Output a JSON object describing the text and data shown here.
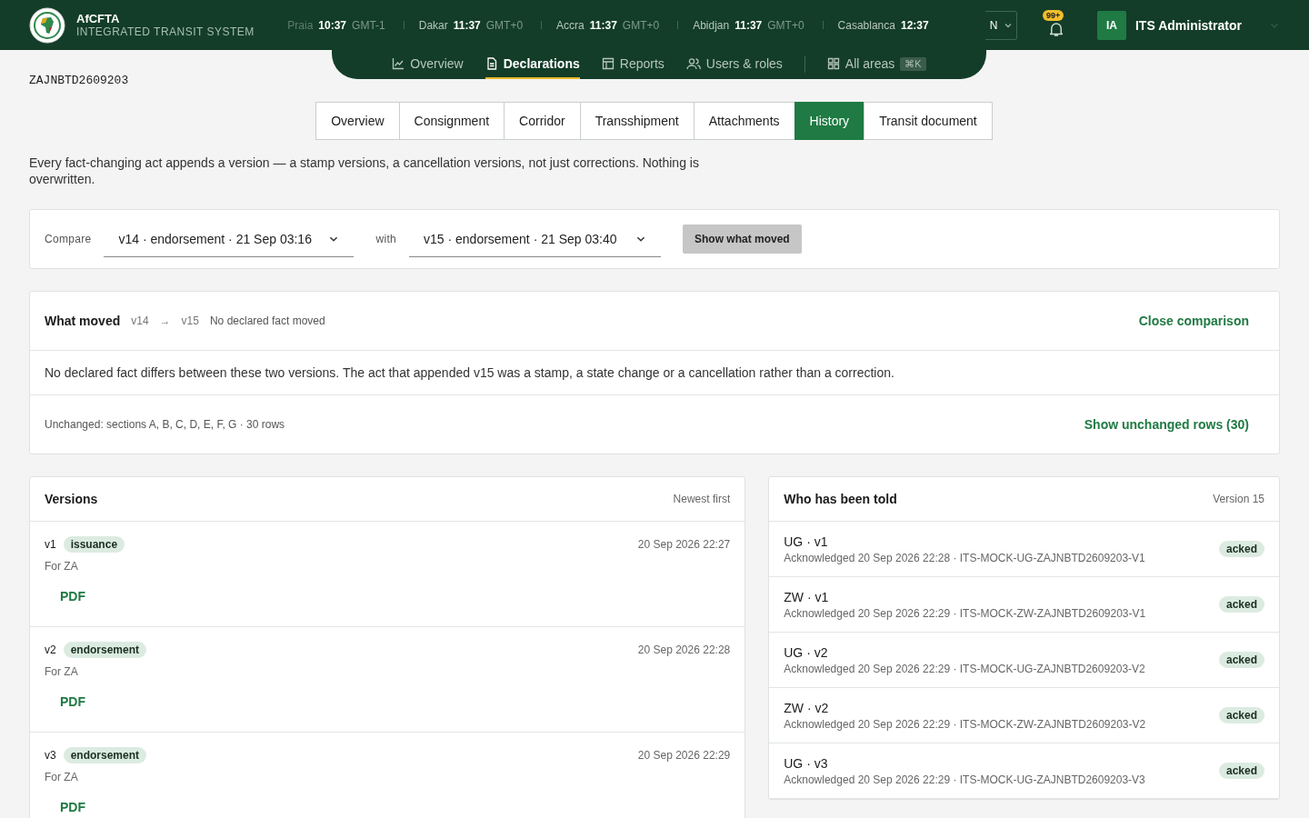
{
  "brand": {
    "name": "AfCFTA",
    "subtitle": "INTEGRATED TRANSIT SYSTEM"
  },
  "clocks": [
    {
      "city": "Praia",
      "time": "10:37",
      "zone": "GMT-1"
    },
    {
      "city": "Dakar",
      "time": "11:37",
      "zone": "GMT+0"
    },
    {
      "city": "Accra",
      "time": "11:37",
      "zone": "GMT+0"
    },
    {
      "city": "Abidjan",
      "time": "11:37",
      "zone": "GMT+0"
    },
    {
      "city": "Casablanca",
      "time": "12:37"
    }
  ],
  "language": {
    "value": "N"
  },
  "notifications": {
    "badge": "99+"
  },
  "user": {
    "initials": "IA",
    "name": "ITS Administrator"
  },
  "nav": [
    {
      "label": "Overview",
      "selected": false
    },
    {
      "label": "Declarations",
      "selected": true
    },
    {
      "label": "Reports",
      "selected": false
    },
    {
      "label": "Users & roles",
      "selected": false
    },
    {
      "label": "All areas",
      "shortcut": "⌘K",
      "selected": false
    }
  ],
  "reference": "ZAJNBTD2609203",
  "tabs": [
    {
      "label": "Overview",
      "selected": false
    },
    {
      "label": "Consignment",
      "selected": false
    },
    {
      "label": "Corridor",
      "selected": false
    },
    {
      "label": "Transshipment",
      "selected": false
    },
    {
      "label": "Attachments",
      "selected": false
    },
    {
      "label": "History",
      "selected": true
    },
    {
      "label": "Transit document",
      "selected": false
    }
  ],
  "intro": "Every fact-changing act appends a version — a stamp versions, a cancellation versions, not just corrections. Nothing is overwritten.",
  "compare": {
    "label": "Compare",
    "from": "v14 · endorsement · 21 Sep 03:16",
    "with_label": "with",
    "to": "v15 · endorsement · 21 Sep 03:40",
    "button": "Show what moved"
  },
  "what_moved": {
    "title": "What moved",
    "from": "v14",
    "arrow": "→",
    "to": "v15",
    "summary": "No declared fact moved",
    "close": "Close comparison",
    "message": "No declared fact differs between these two versions. The act that appended v15 was a stamp, a state change or a cancellation rather than a correction.",
    "unchanged": "Unchanged: sections A, B, C, D, E, F, G · 30 rows",
    "show_unchanged": "Show unchanged rows (30)"
  },
  "versions": {
    "title": "Versions",
    "sort": "Newest first",
    "items": [
      {
        "version": "v1",
        "type": "issuance",
        "time": "20 Sep 2026 22:27",
        "party": "For ZA",
        "link": "PDF"
      },
      {
        "version": "v2",
        "type": "endorsement",
        "time": "20 Sep 2026 22:28",
        "party": "For ZA",
        "link": "PDF"
      },
      {
        "version": "v3",
        "type": "endorsement",
        "time": "20 Sep 2026 22:29",
        "party": "For ZA",
        "link": "PDF"
      }
    ]
  },
  "told": {
    "title": "Who has been told",
    "version": "Version 15",
    "items": [
      {
        "title": "UG · v1",
        "detail": "Acknowledged 20 Sep 2026 22:28 · ITS-MOCK-UG-ZAJNBTD2609203-V1",
        "status": "acked"
      },
      {
        "title": "ZW · v1",
        "detail": "Acknowledged 20 Sep 2026 22:29 · ITS-MOCK-ZW-ZAJNBTD2609203-V1",
        "status": "acked"
      },
      {
        "title": "UG · v2",
        "detail": "Acknowledged 20 Sep 2026 22:29 · ITS-MOCK-UG-ZAJNBTD2609203-V2",
        "status": "acked"
      },
      {
        "title": "ZW · v2",
        "detail": "Acknowledged 20 Sep 2026 22:29 · ITS-MOCK-ZW-ZAJNBTD2609203-V2",
        "status": "acked"
      },
      {
        "title": "UG · v3",
        "detail": "Acknowledged 20 Sep 2026 22:29 · ITS-MOCK-UG-ZAJNBTD2609203-V3",
        "status": "acked"
      }
    ]
  }
}
